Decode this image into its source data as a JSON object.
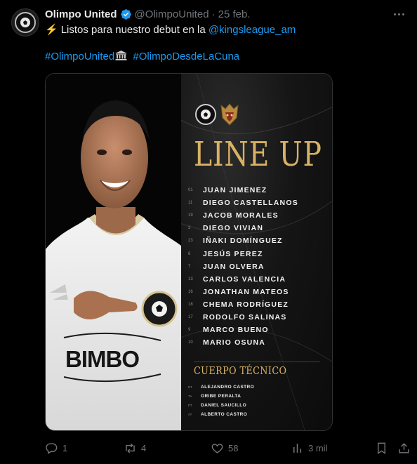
{
  "author": {
    "display_name": "Olimpo United",
    "handle": "@OlimpoUnited",
    "separator": "·",
    "date": "25 feb."
  },
  "tweet": {
    "line1_prefix": "Listos para nuestro debut en la ",
    "mention": "@kingsleague_am",
    "hashtag1": "#OlimpoUnited",
    "hashtag2": "#OlimpoDesdeLaCuna"
  },
  "graphic": {
    "title": "LINE UP",
    "players": [
      {
        "num": "01",
        "name": "JUAN JIMENEZ"
      },
      {
        "num": "11",
        "name": "DIEGO CASTELLANOS"
      },
      {
        "num": "19",
        "name": "JACOB MORALES"
      },
      {
        "num": "3",
        "name": "DIEGO VIVIAN"
      },
      {
        "num": "23",
        "name": "IÑAKI DOMÍNGUEZ"
      },
      {
        "num": "8",
        "name": "JESÚS PEREZ"
      },
      {
        "num": "7",
        "name": "JUAN OLVERA"
      },
      {
        "num": "13",
        "name": "CARLOS VALENCIA"
      },
      {
        "num": "16",
        "name": "JONATHAN MATEOS"
      },
      {
        "num": "18",
        "name": "CHEMA RODRÍGUEZ"
      },
      {
        "num": "17",
        "name": "RODOLFO SALINAS"
      },
      {
        "num": "9",
        "name": "MARCO BUENO"
      },
      {
        "num": "10",
        "name": "MARIO OSUNA"
      }
    ],
    "staff_title": "CUERPO TÉCNICO",
    "staff": [
      {
        "num": "DT",
        "name": "ALEJANDRO CASTRO"
      },
      {
        "num": "TA",
        "name": "ORIBE PERALTA"
      },
      {
        "num": "PT",
        "name": "DANIEL SAUCILLO"
      },
      {
        "num": "AT",
        "name": "ALBERTO CASTRO"
      }
    ],
    "shirt_sponsor": "BIMBO"
  },
  "actions": {
    "replies": "1",
    "reposts": "4",
    "likes": "58",
    "views": "3 mil"
  },
  "icons": [
    "verified-badge-icon",
    "more-icon",
    "lightning-icon",
    "classical-building-icon",
    "reply-icon",
    "repost-icon",
    "like-icon",
    "views-icon",
    "bookmark-icon",
    "share-icon"
  ],
  "colors": {
    "link": "#1d9bf0",
    "muted": "#71767b",
    "gold": "#d9b163",
    "background": "#000000"
  }
}
